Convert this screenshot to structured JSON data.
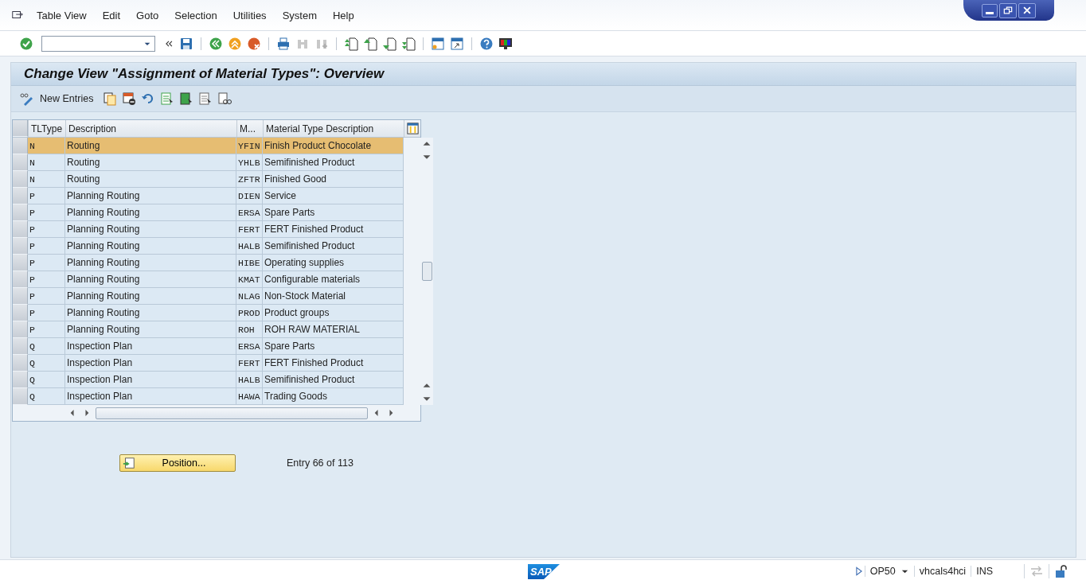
{
  "menu": [
    "Table View",
    "Edit",
    "Goto",
    "Selection",
    "Utilities",
    "System",
    "Help"
  ],
  "screen_title": "Change View \"Assignment of Material Types\": Overview",
  "app_toolbar": {
    "new_entries": "New Entries"
  },
  "table": {
    "columns": [
      "TLType",
      "Description",
      "M...",
      "Material Type Description"
    ],
    "rows": [
      {
        "tltype": "N",
        "description": "Routing",
        "material": "YFIN",
        "material_description": "Finish Product Chocolate",
        "selected": true
      },
      {
        "tltype": "N",
        "description": "Routing",
        "material": "YHLB",
        "material_description": "Semifinished Product",
        "selected": false
      },
      {
        "tltype": "N",
        "description": "Routing",
        "material": "ZFTR",
        "material_description": "Finished Good",
        "selected": false
      },
      {
        "tltype": "P",
        "description": "Planning Routing",
        "material": "DIEN",
        "material_description": "Service",
        "selected": false
      },
      {
        "tltype": "P",
        "description": "Planning Routing",
        "material": "ERSA",
        "material_description": "Spare Parts",
        "selected": false
      },
      {
        "tltype": "P",
        "description": "Planning Routing",
        "material": "FERT",
        "material_description": "FERT Finished Product",
        "selected": false
      },
      {
        "tltype": "P",
        "description": "Planning Routing",
        "material": "HALB",
        "material_description": "Semifinished Product",
        "selected": false
      },
      {
        "tltype": "P",
        "description": "Planning Routing",
        "material": "HIBE",
        "material_description": "Operating supplies",
        "selected": false
      },
      {
        "tltype": "P",
        "description": "Planning Routing",
        "material": "KMAT",
        "material_description": "Configurable materials",
        "selected": false
      },
      {
        "tltype": "P",
        "description": "Planning Routing",
        "material": "NLAG",
        "material_description": "Non-Stock Material",
        "selected": false
      },
      {
        "tltype": "P",
        "description": "Planning Routing",
        "material": "PROD",
        "material_description": "Product groups",
        "selected": false
      },
      {
        "tltype": "P",
        "description": "Planning Routing",
        "material": "ROH",
        "material_description": "ROH RAW MATERIAL",
        "selected": false
      },
      {
        "tltype": "Q",
        "description": "Inspection Plan",
        "material": "ERSA",
        "material_description": "Spare Parts",
        "selected": false
      },
      {
        "tltype": "Q",
        "description": "Inspection Plan",
        "material": "FERT",
        "material_description": "FERT Finished Product",
        "selected": false
      },
      {
        "tltype": "Q",
        "description": "Inspection Plan",
        "material": "HALB",
        "material_description": "Semifinished Product",
        "selected": false
      },
      {
        "tltype": "Q",
        "description": "Inspection Plan",
        "material": "HAWA",
        "material_description": "Trading Goods",
        "selected": false
      }
    ]
  },
  "position_button": "Position...",
  "entry_info": "Entry 66 of 113",
  "status_bar": {
    "logo": "SAP",
    "transaction": "OP50",
    "server": "vhcals4hci",
    "mode": "INS"
  }
}
